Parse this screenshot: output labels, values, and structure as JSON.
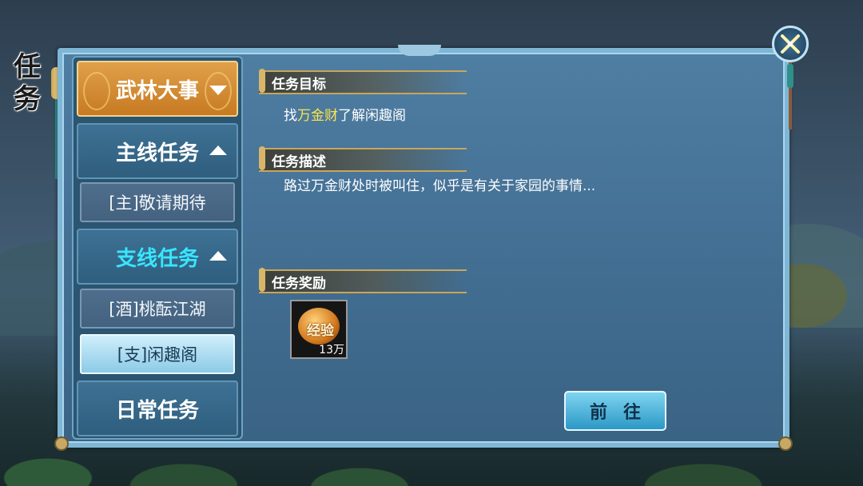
{
  "page_title": "任\n务",
  "sidebar": {
    "categories": [
      {
        "label": "武林大事",
        "state": "collapsed-arrow-down"
      },
      {
        "label": "主线任务",
        "state": "expanded"
      },
      {
        "label": "支线任务",
        "state": "expanded-active"
      },
      {
        "label": "日常任务",
        "state": "collapsed"
      }
    ],
    "sub_items": [
      {
        "label": "[主]敬请期待"
      },
      {
        "label": "[酒]桃酝江湖"
      },
      {
        "label": "[支]闲趣阁",
        "selected": true
      }
    ]
  },
  "content": {
    "objective": {
      "header": "任务目标",
      "prefix": "找",
      "highlight": "万金财",
      "suffix": "了解闲趣阁"
    },
    "description": {
      "header": "任务描述",
      "text": "路过万金财处时被叫住，似乎是有关于家园的事情..."
    },
    "reward": {
      "header": "任务奖励",
      "item_label": "经验",
      "quantity": "13万"
    },
    "go_button": "前往"
  },
  "colors": {
    "highlight": "#ffe44a",
    "active_category": "#38e6ff",
    "wulin_tab": "#c77a22"
  },
  "icons": [
    "close-icon",
    "arrow-down-icon",
    "arrow-up-icon",
    "exp-icon"
  ]
}
